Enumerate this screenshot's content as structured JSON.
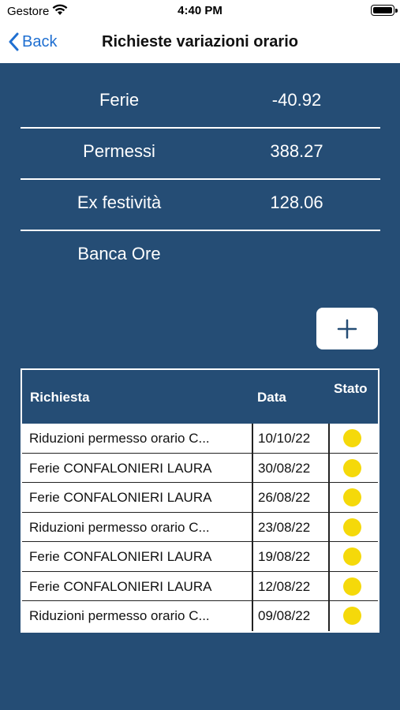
{
  "status_bar": {
    "carrier": "Gestore",
    "time": "4:40 PM"
  },
  "nav": {
    "back_label": "Back",
    "title": "Richieste variazioni orario"
  },
  "summary": [
    {
      "label": "Ferie",
      "value": "-40.92"
    },
    {
      "label": "Permessi",
      "value": "388.27"
    },
    {
      "label": "Ex festività",
      "value": "128.06"
    },
    {
      "label": "Banca Ore",
      "value": ""
    }
  ],
  "table": {
    "headers": {
      "richiesta": "Richiesta",
      "data": "Data",
      "stato": "Stato"
    },
    "rows": [
      {
        "richiesta": "Riduzioni permesso orario C...",
        "data": "10/10/22",
        "status_color": "#f5d90a"
      },
      {
        "richiesta": "Ferie CONFALONIERI LAURA",
        "data": "30/08/22",
        "status_color": "#f5d90a"
      },
      {
        "richiesta": "Ferie CONFALONIERI LAURA",
        "data": "26/08/22",
        "status_color": "#f5d90a"
      },
      {
        "richiesta": "Riduzioni permesso orario C...",
        "data": "23/08/22",
        "status_color": "#f5d90a"
      },
      {
        "richiesta": "Ferie CONFALONIERI LAURA",
        "data": "19/08/22",
        "status_color": "#f5d90a"
      },
      {
        "richiesta": "Ferie CONFALONIERI LAURA",
        "data": "12/08/22",
        "status_color": "#f5d90a"
      },
      {
        "richiesta": "Riduzioni permesso orario C...",
        "data": "09/08/22",
        "status_color": "#f5d90a"
      }
    ]
  },
  "colors": {
    "background": "#254d75",
    "accent": "#1f6fd1",
    "status_pending": "#f5d90a"
  },
  "icons": {
    "back": "chevron-left-icon",
    "add": "plus-icon",
    "wifi": "wifi-icon",
    "battery": "battery-icon"
  }
}
